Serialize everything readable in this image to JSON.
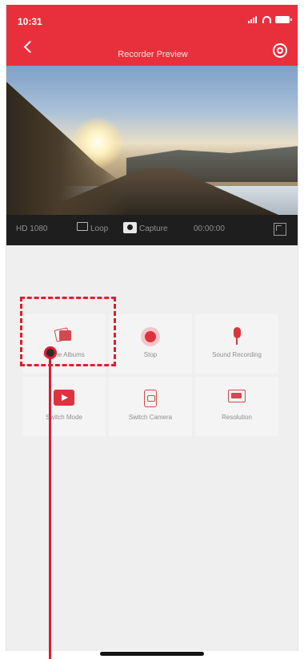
{
  "status_bar": {
    "time": "10:31"
  },
  "header": {
    "title": "Recorder Preview"
  },
  "toolbar": {
    "resolution": "HD 1080",
    "live_label": "Loop",
    "capture_label": "Capture",
    "duration": "00:00:00"
  },
  "grid": {
    "items": [
      {
        "label": "Online Albums",
        "icon": "album-icon"
      },
      {
        "label": "Stop",
        "icon": "stop-icon"
      },
      {
        "label": "Sound Recording",
        "icon": "microphone-icon"
      },
      {
        "label": "Switch Mode",
        "icon": "video-camera-icon"
      },
      {
        "label": "Switch Camera",
        "icon": "switch-camera-icon"
      },
      {
        "label": "Resolution",
        "icon": "hd-icon"
      }
    ]
  },
  "colors": {
    "accent": "#e8303c",
    "highlight": "#e01e30",
    "toolbar": "#1e1e1e"
  }
}
